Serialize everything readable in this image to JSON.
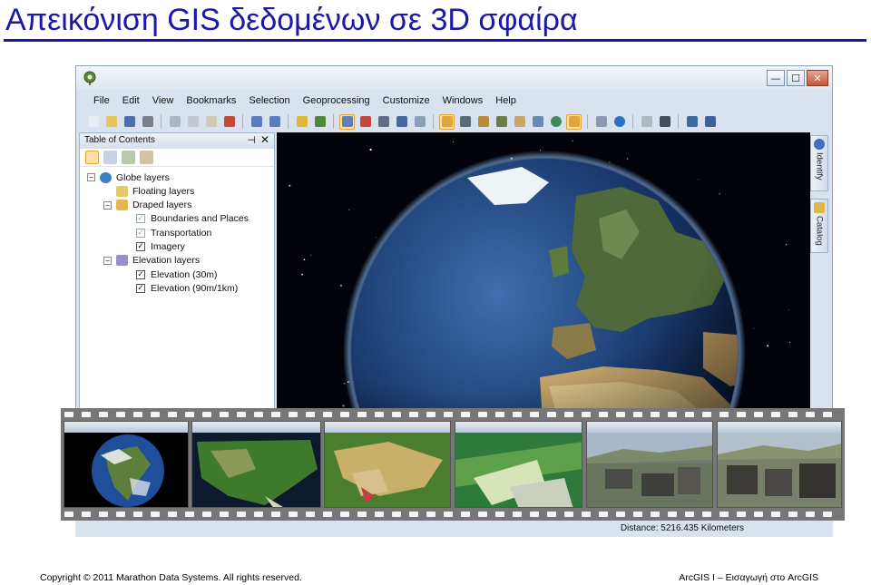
{
  "slide": {
    "title": "Απεικόνιση GIS δεδομένων σε 3D σφαίρα",
    "accent_color": "#1a1aa6"
  },
  "window": {
    "buttons": {
      "minimize": "—",
      "maximize": "☐",
      "close": "✕"
    }
  },
  "menubar": {
    "items": [
      "File",
      "Edit",
      "View",
      "Bookmarks",
      "Selection",
      "Geoprocessing",
      "Customize",
      "Windows",
      "Help"
    ]
  },
  "toolbar": {
    "icons": [
      "new-document-icon",
      "open-folder-icon",
      "save-icon",
      "print-icon",
      "cut-icon",
      "copy-icon",
      "paste-icon",
      "delete-icon",
      "undo-icon",
      "redo-icon",
      "add-data-icon",
      "layer-icon",
      "full-extent-icon",
      "bookmark-icon",
      "identify-icon",
      "map-view-icon",
      "link-icon",
      "navigate-icon",
      "fly-icon",
      "observer-icon",
      "target-icon",
      "pan-icon",
      "zoom-icon",
      "globe-icon",
      "spin-icon",
      "select-icon",
      "info-icon",
      "measure-icon",
      "binoculars-icon",
      "xy-icon",
      "tools-icon"
    ]
  },
  "toc": {
    "title": "Table of Contents",
    "pin": "⊣",
    "close": "✕",
    "layers": [
      {
        "label": "Globe layers",
        "level": 0,
        "expander": "−",
        "icon": "globe-layer-icon"
      },
      {
        "label": "Floating layers",
        "level": 1,
        "icon": "floating-layer-icon"
      },
      {
        "label": "Draped layers",
        "level": 1,
        "expander": "−",
        "icon": "draped-layer-icon"
      },
      {
        "label": "Boundaries and Places",
        "level": 2,
        "checked": false
      },
      {
        "label": "Transportation",
        "level": 2,
        "checked": false
      },
      {
        "label": "Imagery",
        "level": 2,
        "checked": true
      },
      {
        "label": "Elevation layers",
        "level": 1,
        "expander": "−",
        "icon": "elevation-layer-icon"
      },
      {
        "label": "Elevation (30m)",
        "level": 2,
        "checked": true
      },
      {
        "label": "Elevation (90m/1km)",
        "level": 2,
        "checked": true
      }
    ]
  },
  "side_tabs": [
    "Identify",
    "Catalog"
  ],
  "status": {
    "distance": "Distance: 5216.435 Kilometers"
  },
  "footer": {
    "left": "Copyright © 2011 Marathon Data Systems.  All rights reserved.",
    "right": "ArcGIS I – Εισαγωγή στο ArcGIS"
  }
}
